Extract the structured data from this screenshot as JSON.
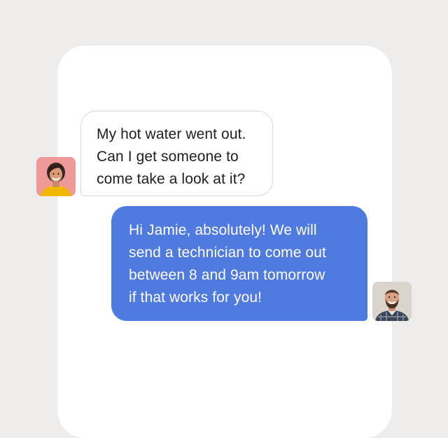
{
  "conversation": {
    "incoming": {
      "sender": "customer",
      "lines": [
        "My hot water went out.",
        "Can I get someone to",
        "come take a look at it?"
      ]
    },
    "outgoing": {
      "sender": "agent",
      "lines": [
        "Hi Jamie, absolutely! We will",
        "send a technician to come out",
        "between 8 and 9am tomorrow",
        "if that works for you!"
      ]
    }
  },
  "colors": {
    "page_background": "#efedeb",
    "card_background": "#ffffff",
    "incoming_bubble": "#ffffff",
    "outgoing_bubble": "#4f7ae0",
    "customer_avatar_bg": "#ee9a98",
    "agent_avatar_bg": "#d9d4ce"
  },
  "icons": {
    "customer_avatar": "woman-portrait-avatar",
    "agent_avatar": "man-portrait-avatar"
  }
}
